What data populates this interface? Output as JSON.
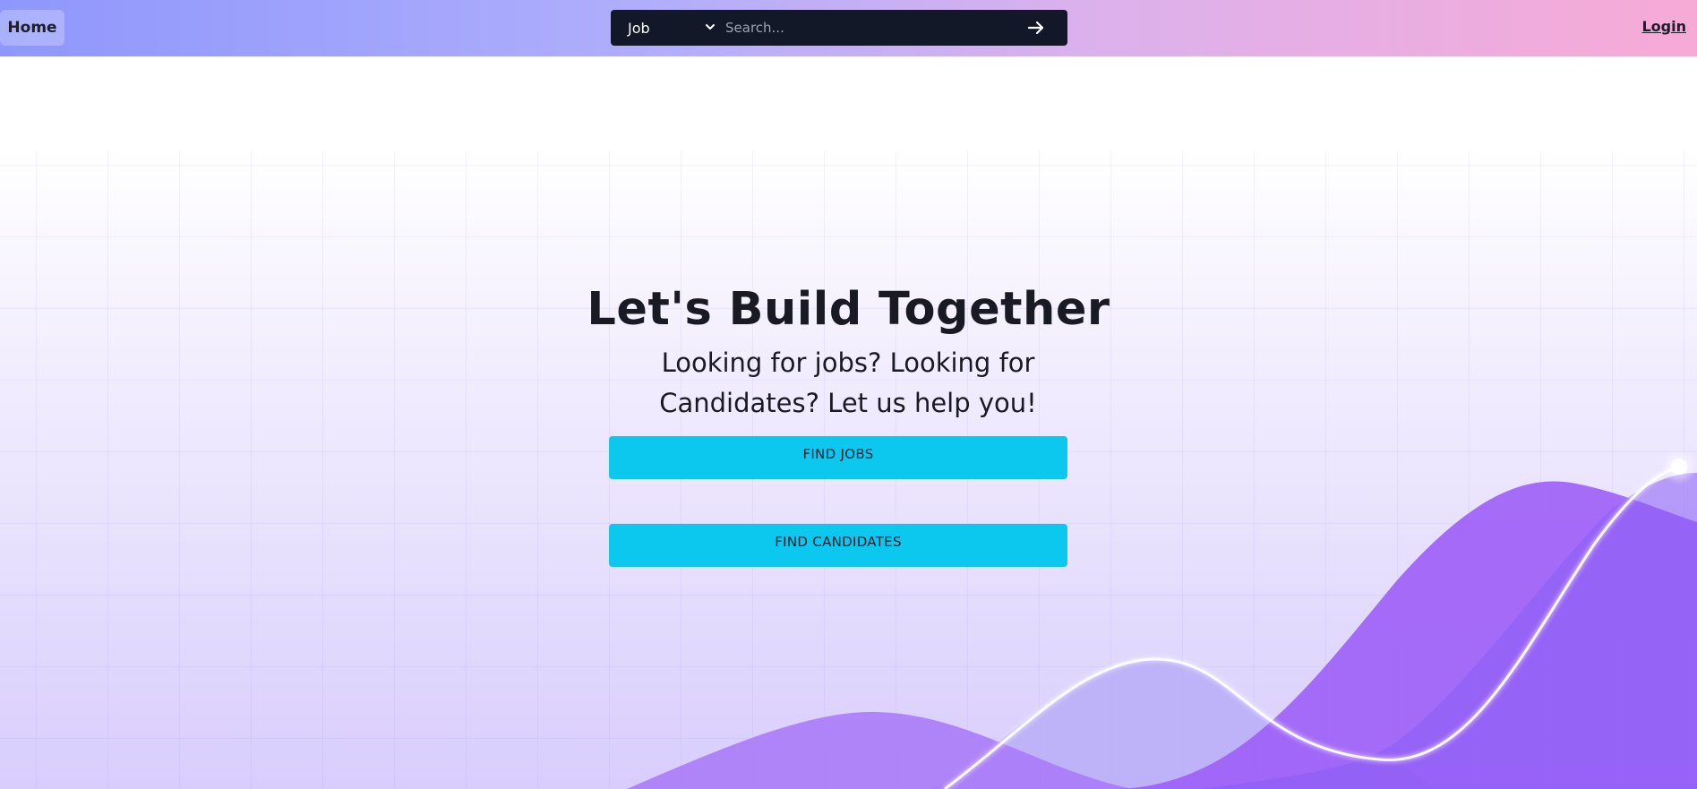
{
  "nav": {
    "home_label": "Home",
    "login_label": "Login",
    "search": {
      "category": "Job",
      "placeholder": "Search...",
      "submit_icon": "arrow-right-icon"
    }
  },
  "hero": {
    "title": "Let's Build Together",
    "subtitle": "Looking for jobs? Looking for Candidates? Let us help you!",
    "find_jobs_label": "FIND JOBS",
    "find_candidates_label": "FIND CANDIDATES"
  },
  "colors": {
    "nav_gradient_start": "#8e97fb",
    "nav_gradient_end": "#f7aad6",
    "search_bg": "#121827",
    "cta_bg": "#0cc8ef",
    "wave_purple": "#8b5cf6"
  }
}
